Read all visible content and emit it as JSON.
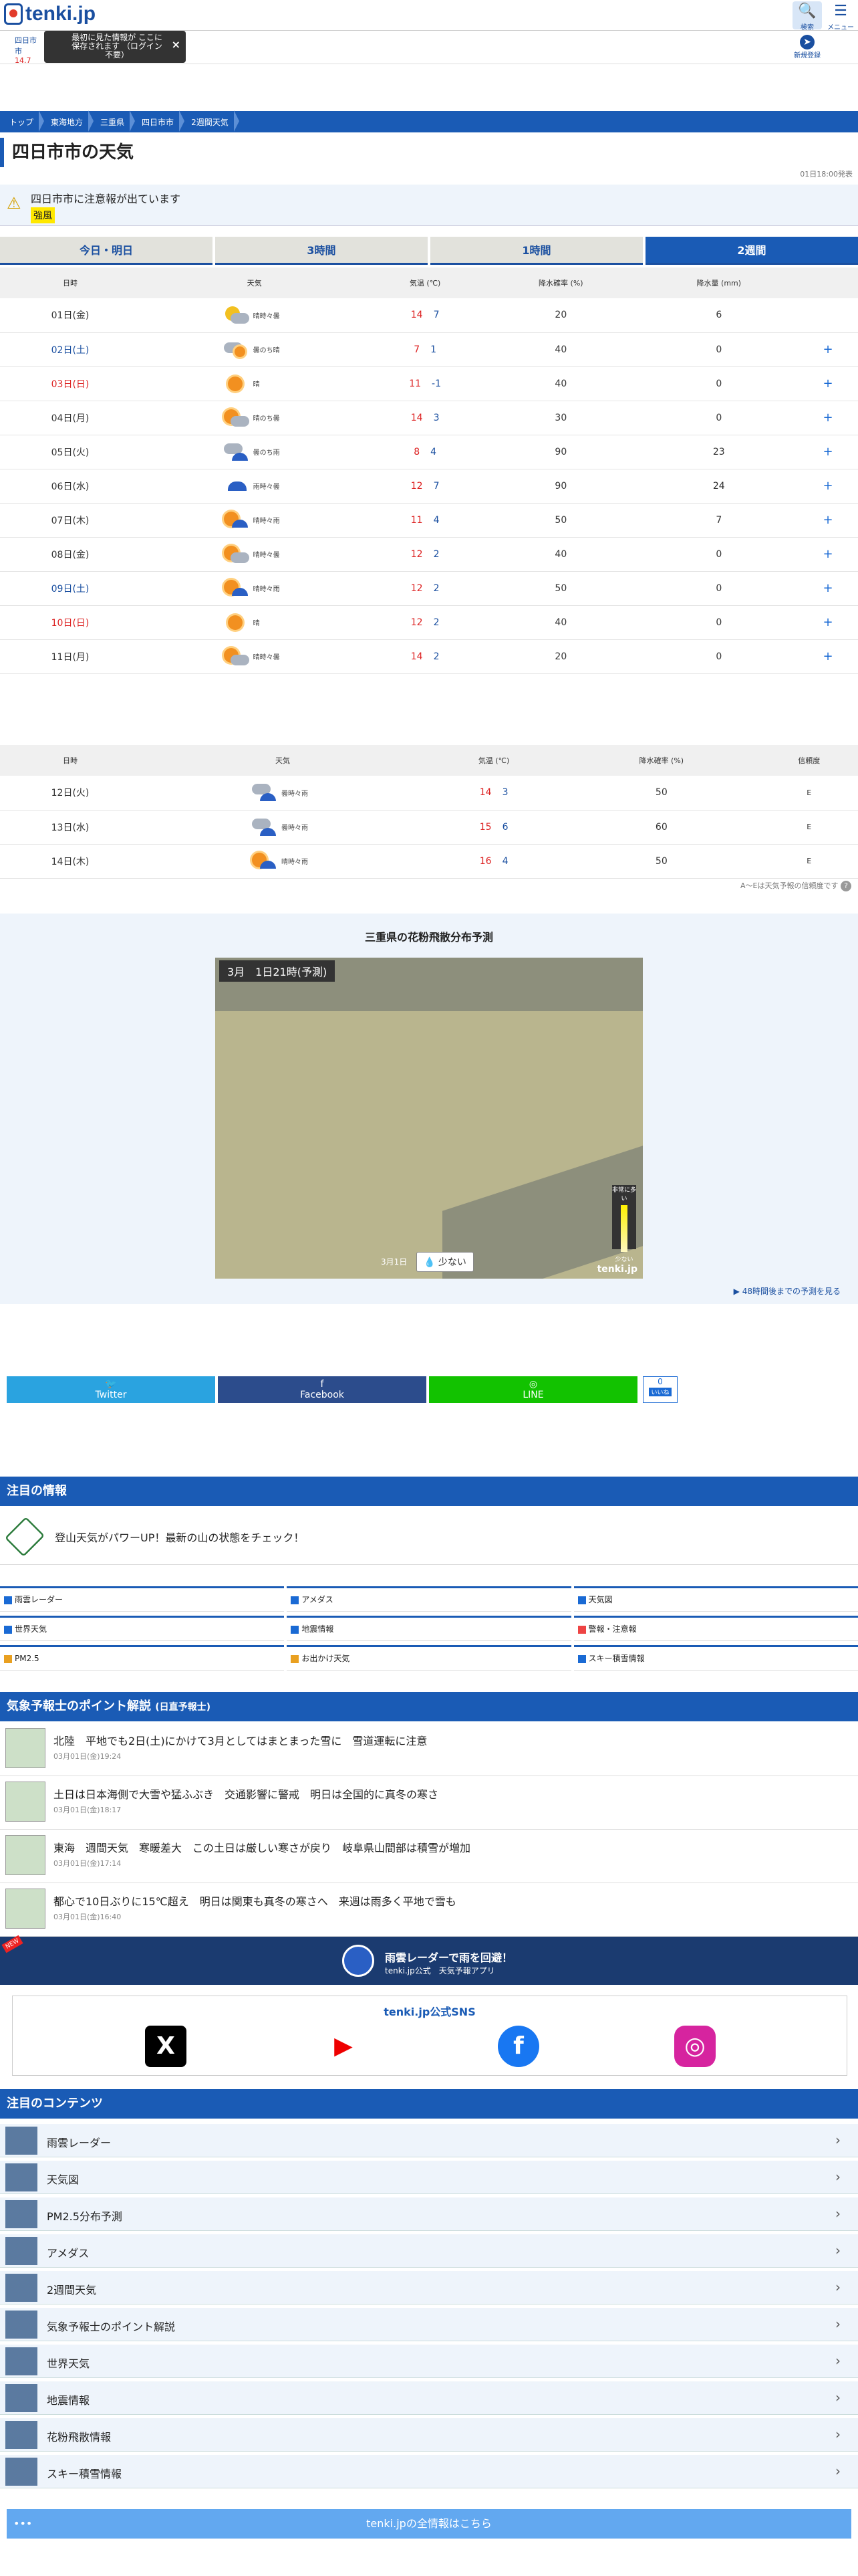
{
  "header": {
    "logo": "tenki.jp",
    "search": "検索",
    "menu": "メニュー"
  },
  "favorite": {
    "city": "四日市市",
    "temp": "14.7",
    "tooltip": "最初に見た情報が ここに保存されます （ログイン不要）",
    "close": "×",
    "register_label": "新規登録"
  },
  "breadcrumb": [
    "トップ",
    "東海地方",
    "三重県",
    "四日市市",
    "2週間天気"
  ],
  "title": "四日市市の天気",
  "updated": "01日18:00発表",
  "warning": {
    "text": "四日市市に注意報が出ています",
    "badge": "強風"
  },
  "tabs": [
    "今日・明日",
    "3時間",
    "1時間",
    "2週間"
  ],
  "table1": {
    "headers": [
      "日時",
      "天気",
      "気温 (℃)",
      "降水確率 (%)",
      "降水量 (mm)"
    ],
    "rows": [
      {
        "date": "01日(金)",
        "cls": "",
        "weather": "晴時々曇",
        "icon": "moon-cloud",
        "hi": "14",
        "lo": "7",
        "pop": "20",
        "rain": "6",
        "plus": ""
      },
      {
        "date": "02日(土)",
        "cls": "sat",
        "weather": "曇のち晴",
        "icon": "cloud-sun",
        "hi": "7",
        "lo": "1",
        "pop": "40",
        "rain": "0",
        "plus": "+"
      },
      {
        "date": "03日(日)",
        "cls": "sun",
        "weather": "晴",
        "icon": "sun",
        "hi": "11",
        "lo": "-1",
        "pop": "40",
        "rain": "0",
        "plus": "+"
      },
      {
        "date": "04日(月)",
        "cls": "",
        "weather": "晴のち曇",
        "icon": "sun-cloud",
        "hi": "14",
        "lo": "3",
        "pop": "30",
        "rain": "0",
        "plus": "+"
      },
      {
        "date": "05日(火)",
        "cls": "",
        "weather": "曇のち雨",
        "icon": "cloud-rain",
        "hi": "8",
        "lo": "4",
        "pop": "90",
        "rain": "23",
        "plus": "+"
      },
      {
        "date": "06日(水)",
        "cls": "",
        "weather": "雨時々曇",
        "icon": "rain",
        "hi": "12",
        "lo": "7",
        "pop": "90",
        "rain": "24",
        "plus": "+"
      },
      {
        "date": "07日(木)",
        "cls": "",
        "weather": "晴時々雨",
        "icon": "sun-rain",
        "hi": "11",
        "lo": "4",
        "pop": "50",
        "rain": "7",
        "plus": "+"
      },
      {
        "date": "08日(金)",
        "cls": "",
        "weather": "晴時々曇",
        "icon": "sun-cloud",
        "hi": "12",
        "lo": "2",
        "pop": "40",
        "rain": "0",
        "plus": "+"
      },
      {
        "date": "09日(土)",
        "cls": "sat",
        "weather": "晴時々雨",
        "icon": "sun-rain",
        "hi": "12",
        "lo": "2",
        "pop": "50",
        "rain": "0",
        "plus": "+"
      },
      {
        "date": "10日(日)",
        "cls": "sun",
        "weather": "晴",
        "icon": "sun",
        "hi": "12",
        "lo": "2",
        "pop": "40",
        "rain": "0",
        "plus": "+"
      },
      {
        "date": "11日(月)",
        "cls": "",
        "weather": "晴時々曇",
        "icon": "sun-cloud",
        "hi": "14",
        "lo": "2",
        "pop": "20",
        "rain": "0",
        "plus": "+"
      }
    ]
  },
  "table2": {
    "headers": [
      "日時",
      "天気",
      "気温 (℃)",
      "降水確率 (%)",
      "信頼度"
    ],
    "rows": [
      {
        "date": "12日(火)",
        "weather": "曇時々雨",
        "icon": "cloud-rain",
        "hi": "14",
        "lo": "3",
        "pop": "50",
        "rel": "E"
      },
      {
        "date": "13日(水)",
        "weather": "曇時々雨",
        "icon": "cloud-rain",
        "hi": "15",
        "lo": "6",
        "pop": "60",
        "rel": "E"
      },
      {
        "date": "14日(木)",
        "weather": "晴時々雨",
        "icon": "sun-rain",
        "hi": "16",
        "lo": "4",
        "pop": "50",
        "rel": "E"
      }
    ]
  },
  "reliability_note": "A～Eは天気予報の信頼度です",
  "pollen": {
    "title": "三重県の花粉飛散分布予測",
    "time_label": "3月　1日21時(予測)",
    "date": "3月1日",
    "level": "少ない",
    "legend_high": "非常に多い",
    "legend_low": "少ない",
    "brand": "tenki.jp",
    "more": "48時間後までの予測を見る"
  },
  "share": {
    "twitter": "Twitter",
    "facebook": "Facebook",
    "line": "LINE",
    "count": "0",
    "count_label": "いいね"
  },
  "attention": {
    "title": "注目の情報",
    "text": "登山天気がパワーUP！最新の山の状態をチェック！"
  },
  "links": [
    "雨雲レーダー",
    "アメダス",
    "天気図",
    "世界天気",
    "地震情報",
    "警報・注意報",
    "PM2.5",
    "お出かけ天気",
    "スキー積雪情報"
  ],
  "points": {
    "title": "気象予報士のポイント解説",
    "sub": "(日直予報士)",
    "items": [
      {
        "title": "北陸　平地でも2日(土)にかけて3月としてはまとまった雪に　雪道運転に注意",
        "date": "03月01日(金)19:24"
      },
      {
        "title": "土日は日本海側で大雪や猛ふぶき　交通影響に警戒　明日は全国的に真冬の寒さ",
        "date": "03月01日(金)18:17"
      },
      {
        "title": "東海　週間天気　寒暖差大　この土日は厳しい寒さが戻り　岐阜県山間部は積雪が増加",
        "date": "03月01日(金)17:14"
      },
      {
        "title": "都心で10日ぶりに15℃超え　明日は関東も真冬の寒さへ　来週は雨多く平地で雪も",
        "date": "03月01日(金)16:40"
      }
    ]
  },
  "banner": {
    "new": "NEW",
    "title": "雨雲レーダーで雨を回避！",
    "sub": "tenki.jp公式　天気予報アプリ"
  },
  "sns": {
    "title": "tenki.jp公式SNS"
  },
  "contents": {
    "title": "注目のコンテンツ",
    "items": [
      "雨雲レーダー",
      "天気図",
      "PM2.5分布予測",
      "アメダス",
      "2週間天気",
      "気象予報士のポイント解説",
      "世界天気",
      "地震情報",
      "花粉飛散情報",
      "スキー積雪情報"
    ]
  },
  "all_info": "tenki.jpの全情報はこちら"
}
